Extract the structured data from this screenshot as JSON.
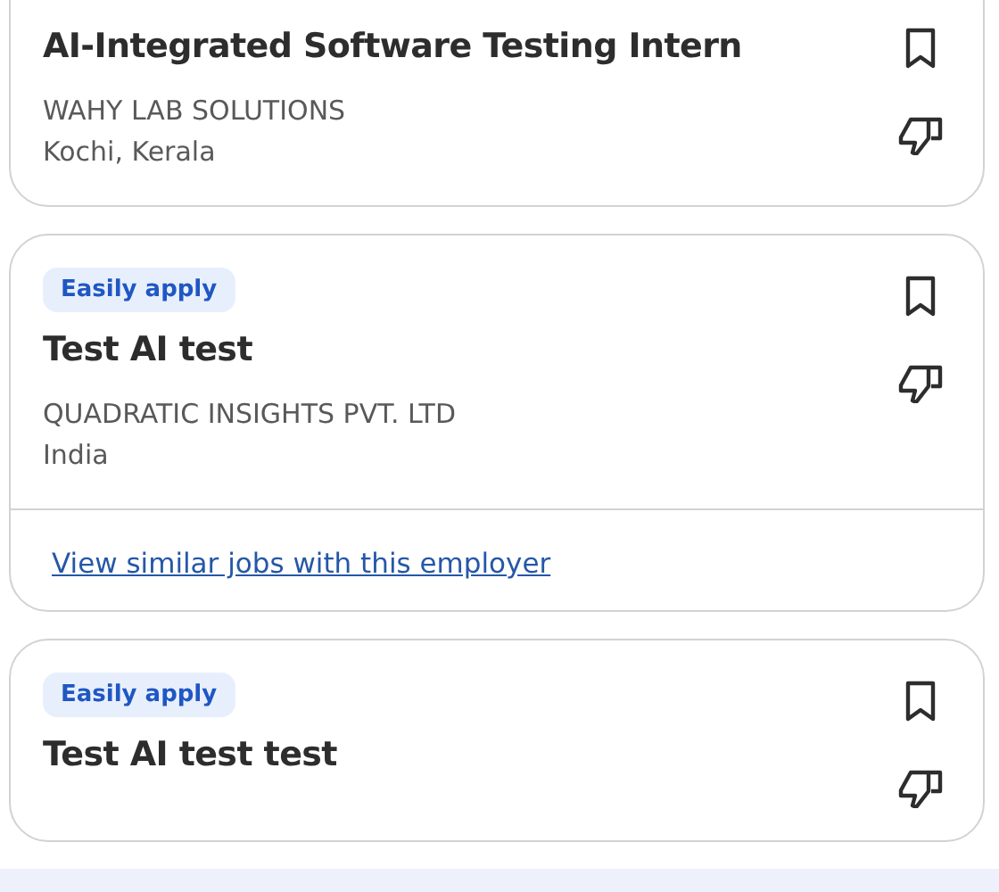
{
  "jobs": [
    {
      "title": "AI-Integrated Software Testing Intern",
      "company": "WAHY LAB SOLUTIONS",
      "location": "Kochi, Kerala"
    },
    {
      "badge": "Easily apply",
      "title": "Test AI test",
      "company": "QUADRATIC INSIGHTS PVT. LTD",
      "location": "India",
      "link": "View similar jobs with this employer"
    },
    {
      "badge": "Easily apply",
      "title": "Test AI test test"
    }
  ]
}
